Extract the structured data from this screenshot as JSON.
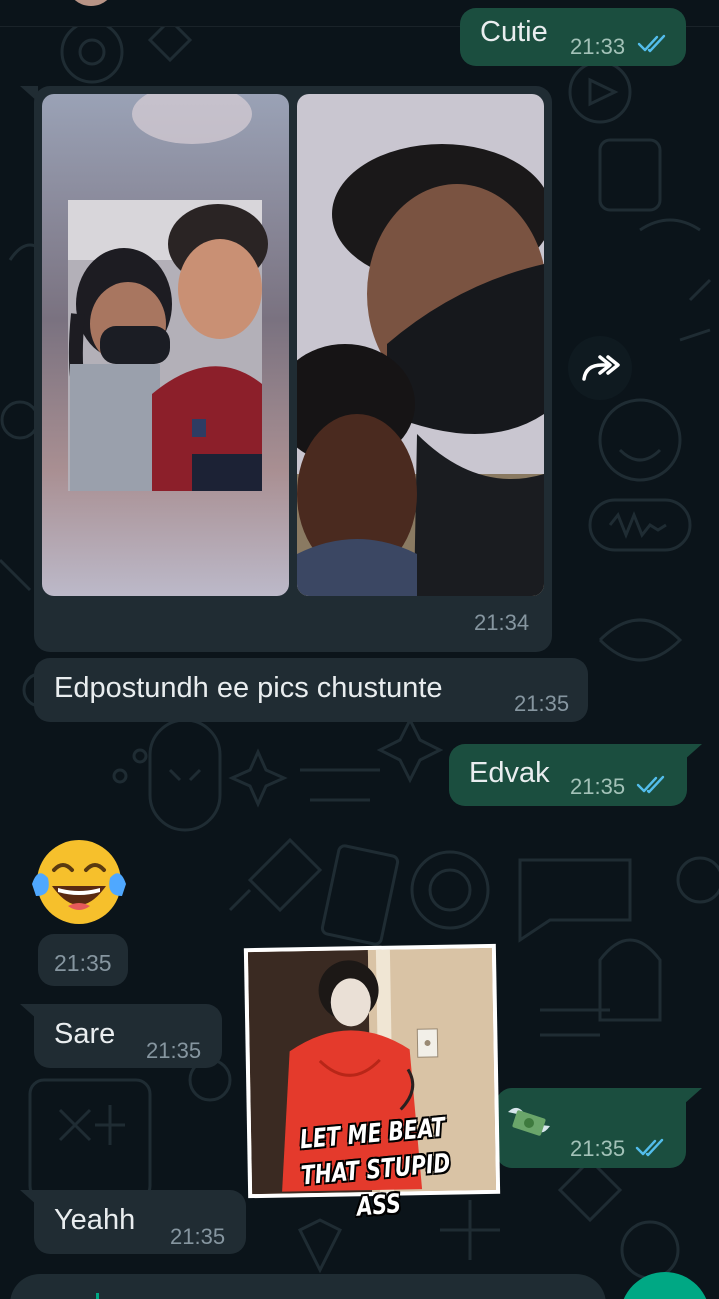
{
  "colors": {
    "background": "#0b141a",
    "incoming_bubble": "#202c33",
    "outgoing_bubble": "#1b4e3f",
    "read_ticks": "#53bdeb",
    "accent": "#00a884"
  },
  "messages": [
    {
      "direction": "out",
      "text": "Cutie",
      "time": "21:33",
      "status": "read"
    },
    {
      "direction": "in",
      "type": "photo-album",
      "photos": 2,
      "time": "21:34"
    },
    {
      "direction": "in",
      "text": "Edpostundh ee pics chustunte",
      "time": "21:35"
    },
    {
      "direction": "out",
      "text": "Edvak",
      "time": "21:35",
      "status": "read"
    },
    {
      "direction": "in",
      "type": "emoji",
      "emoji": "face-with-tears-of-joy",
      "time": "21:35"
    },
    {
      "direction": "in",
      "text": "Sare",
      "time": "21:35"
    },
    {
      "direction": "out",
      "type": "sticker",
      "sticker_caption": "LET ME BEAT THAT STUPID ASS",
      "emoji": "money-with-wings",
      "time": "21:35",
      "status": "read"
    },
    {
      "direction": "in",
      "text": "Yeahh",
      "time": "21:35"
    }
  ],
  "icons": {
    "forward": "forward-icon",
    "read_receipt": "double-check-icon",
    "microphone": "mic-icon"
  }
}
